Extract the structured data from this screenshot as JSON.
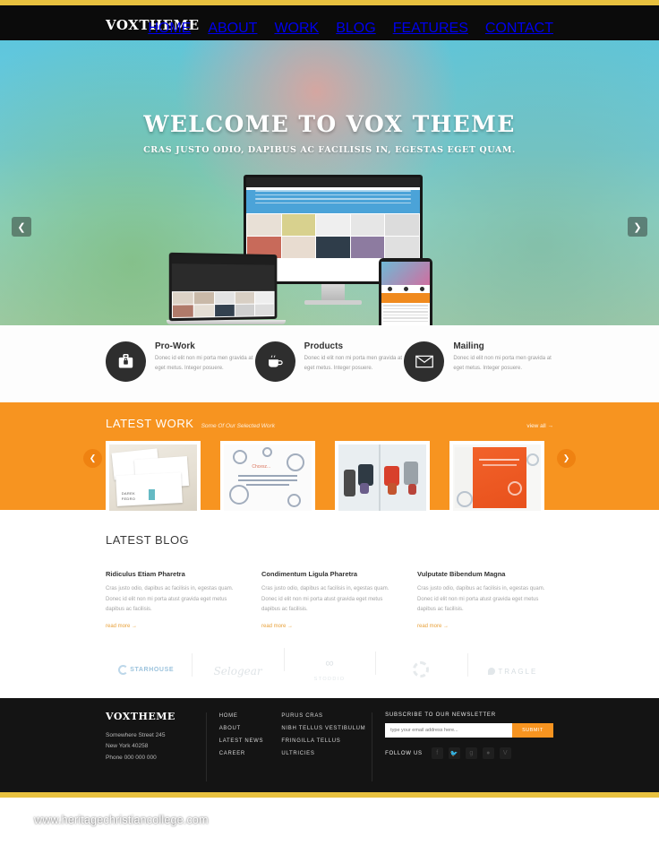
{
  "brand": {
    "name": "VOXTHEME",
    "accent_orange": "#f79420",
    "accent_gold": "#e8c13f",
    "accent_cyan": "#3fc6e0"
  },
  "nav": {
    "items": [
      {
        "label": "HOME",
        "active": true
      },
      {
        "label": "ABOUT",
        "active": false
      },
      {
        "label": "WORK",
        "active": false
      },
      {
        "label": "BLOG",
        "active": false
      },
      {
        "label": "FEATURES",
        "active": false
      },
      {
        "label": "CONTACT",
        "active": false
      }
    ]
  },
  "hero": {
    "title": "WELCOME TO VOX THEME",
    "subtitle": "CRAS JUSTO ODIO, DAPIBUS AC FACILISIS IN, EGESTAS EGET QUAM.",
    "prev_icon": "chevron-left-icon",
    "next_icon": "chevron-right-icon"
  },
  "services": {
    "items": [
      {
        "icon": "briefcase-lock-icon",
        "title": "Pro-Work",
        "text": "Donec id elit non mi porta men gravida at eget metus. Integer posuere."
      },
      {
        "icon": "coffee-cup-icon",
        "title": "Products",
        "text": "Donec id elit non mi porta men gravida at eget metus. Integer posuere."
      },
      {
        "icon": "envelope-icon",
        "title": "Mailing",
        "text": "Donec id elit non mi porta men gravida at eget metus. Integer posuere."
      }
    ]
  },
  "work": {
    "title": "LATEST WORK",
    "subtitle": "Some Of Our Selected Work",
    "view_all": "view all  →",
    "prev_icon": "chevron-left-icon",
    "next_icon": "chevron-right-icon",
    "items": [
      {
        "name": "DAREK FEDRO folded cards"
      },
      {
        "name": "Illustrated booklet cover"
      },
      {
        "name": "Robot character illustrations"
      },
      {
        "name": "Orange folder print design"
      }
    ]
  },
  "blog": {
    "title": "LATEST BLOG",
    "posts": [
      {
        "title": "Ridiculus Etiam Pharetra",
        "excerpt": "Cras justo odio, dapibus ac facilisis in, egestas quam. Donec id elit non mi porta atust gravida eget metus dapibus ac facilisis.",
        "read_more": "read more  →"
      },
      {
        "title": "Condimentum Ligula Pharetra",
        "excerpt": "Cras justo odio, dapibus ac facilisis in, egestas quam. Donec id elit non mi porta atust gravida eget metus dapibus ac facilisis.",
        "read_more": "read more  →"
      },
      {
        "title": "Vulputate Bibendum Magna",
        "excerpt": "Cras justo odio, dapibus ac facilisis in, egestas quam. Donec id elit non mi porta atust gravida eget metus dapibus ac facilisis.",
        "read_more": "read more  →"
      }
    ]
  },
  "clients": {
    "items": [
      {
        "label": "STARHOUSE",
        "icon": "starhouse-logo"
      },
      {
        "label": "Selogear",
        "icon": "selogear-logo"
      },
      {
        "label": "STODDIO",
        "icon": "stoddio-logo"
      },
      {
        "label": "",
        "icon": "gear-logo"
      },
      {
        "label": "TRAGLE",
        "icon": "tragle-logo"
      }
    ]
  },
  "footer": {
    "logo": "VOXTHEME",
    "address_line1": "Somewhere Street 245",
    "address_line2": "New York 40258",
    "address_line3": "Phone 000 000 000",
    "links_col1": [
      "HOME",
      "ABOUT",
      "LATEST NEWS",
      "CAREER"
    ],
    "links_col2": [
      "PURUS CRAS",
      "NIBH TELLUS VESTIBULUM",
      "FRINGILLA TELLUS",
      "ULTRICIES"
    ],
    "newsletter_heading": "SUBSCRIBE TO OUR NEWSLETTER",
    "newsletter_placeholder": "type your email address here...",
    "newsletter_value": "",
    "submit_label": "SUBMIT",
    "follow_label": "FOLLOW US",
    "social": [
      {
        "icon": "facebook-icon",
        "glyph": "f"
      },
      {
        "icon": "twitter-icon",
        "glyph": "t"
      },
      {
        "icon": "google-plus-icon",
        "glyph": "g"
      },
      {
        "icon": "dribbble-icon",
        "glyph": "d"
      },
      {
        "icon": "vimeo-icon",
        "glyph": "V"
      }
    ]
  },
  "watermark": {
    "text": "www.heritagechristiancollege.com"
  }
}
